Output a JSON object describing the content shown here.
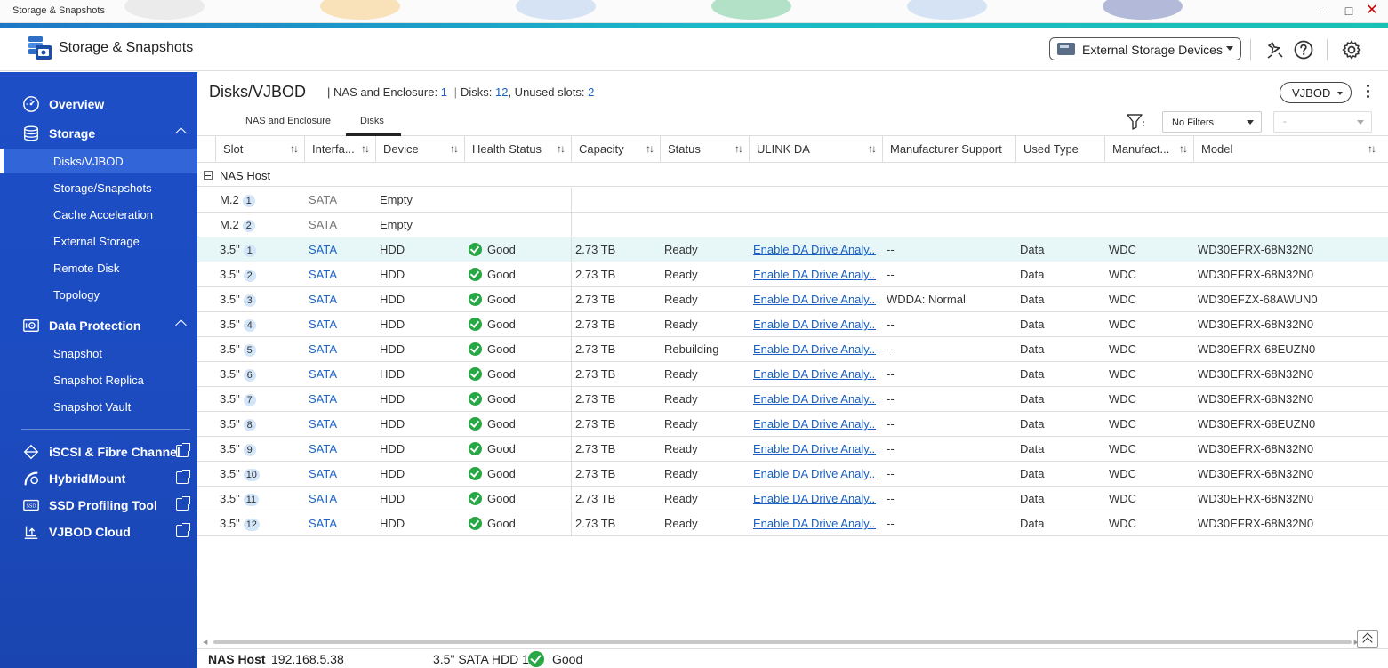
{
  "window": {
    "title": "Storage & Snapshots",
    "min_icon": "minimize-icon",
    "max_icon": "maximize-icon",
    "close_icon": "close-icon"
  },
  "header": {
    "app_title": "Storage & Snapshots",
    "external_devices_label": "External Storage Devices",
    "icons": [
      "pin-tool-icon",
      "help-icon",
      "settings-icon"
    ]
  },
  "sidebar": {
    "sections": [
      {
        "label": "Overview",
        "icon": "gauge-icon"
      },
      {
        "label": "Storage",
        "icon": "database-icon"
      },
      {
        "label": "Data Protection",
        "icon": "safe-icon"
      }
    ],
    "storage_items": [
      "Disks/VJBOD",
      "Storage/Snapshots",
      "Cache Acceleration",
      "External Storage",
      "Remote Disk",
      "Topology"
    ],
    "protection_items": [
      "Snapshot",
      "Snapshot Replica",
      "Snapshot Vault"
    ],
    "tools": [
      {
        "label": "iSCSI & Fibre Channel",
        "icon": "iscsi-icon"
      },
      {
        "label": "HybridMount",
        "icon": "hybridmount-icon"
      },
      {
        "label": "SSD Profiling Tool",
        "icon": "ssd-icon"
      },
      {
        "label": "VJBOD Cloud",
        "icon": "cloud-disk-icon"
      }
    ],
    "active_item": "Disks/VJBOD"
  },
  "page": {
    "title": "Disks/VJBOD",
    "nas_label": "NAS and Enclosure:",
    "nas_count": "1",
    "disks_label": "Disks:",
    "disks_count": "12",
    "unused_label": ", Unused slots:",
    "unused_count": "2",
    "separator": "|",
    "vjbod_button": "VJBOD"
  },
  "tabs": [
    "NAS and Enclosure",
    "Disks"
  ],
  "active_tab": "Disks",
  "filters": {
    "filter_value": "No Filters",
    "secondary_value": "-"
  },
  "table": {
    "columns": [
      "Slot",
      "Interfa...",
      "Device",
      "Health Status",
      "Capacity",
      "Status",
      "ULINK DA",
      "Manufacturer Support",
      "Used Type",
      "Manufact...",
      "Model"
    ],
    "group": "NAS Host",
    "rows": [
      {
        "slot": "M.2",
        "num": "1",
        "iface": "SATA",
        "device": "Empty"
      },
      {
        "slot": "M.2",
        "num": "2",
        "iface": "SATA",
        "device": "Empty"
      },
      {
        "slot": "3.5\"",
        "num": "1",
        "iface": "SATA",
        "device": "HDD",
        "health": "Good",
        "capacity": "2.73 TB",
        "status": "Ready",
        "ulink": "Enable DA Drive Analy...",
        "support": "--",
        "used": "Data",
        "manufacturer": "WDC",
        "model": "WD30EFRX-68N32N0"
      },
      {
        "slot": "3.5\"",
        "num": "2",
        "iface": "SATA",
        "device": "HDD",
        "health": "Good",
        "capacity": "2.73 TB",
        "status": "Ready",
        "ulink": "Enable DA Drive Analy...",
        "support": "--",
        "used": "Data",
        "manufacturer": "WDC",
        "model": "WD30EFRX-68N32N0"
      },
      {
        "slot": "3.5\"",
        "num": "3",
        "iface": "SATA",
        "device": "HDD",
        "health": "Good",
        "capacity": "2.73 TB",
        "status": "Ready",
        "ulink": "Enable DA Drive Analy...",
        "support": "WDDA: Normal",
        "used": "Data",
        "manufacturer": "WDC",
        "model": "WD30EFZX-68AWUN0"
      },
      {
        "slot": "3.5\"",
        "num": "4",
        "iface": "SATA",
        "device": "HDD",
        "health": "Good",
        "capacity": "2.73 TB",
        "status": "Ready",
        "ulink": "Enable DA Drive Analy...",
        "support": "--",
        "used": "Data",
        "manufacturer": "WDC",
        "model": "WD30EFRX-68N32N0"
      },
      {
        "slot": "3.5\"",
        "num": "5",
        "iface": "SATA",
        "device": "HDD",
        "health": "Good",
        "capacity": "2.73 TB",
        "status": "Rebuilding",
        "ulink": "Enable DA Drive Analy...",
        "support": "--",
        "used": "Data",
        "manufacturer": "WDC",
        "model": "WD30EFRX-68EUZN0"
      },
      {
        "slot": "3.5\"",
        "num": "6",
        "iface": "SATA",
        "device": "HDD",
        "health": "Good",
        "capacity": "2.73 TB",
        "status": "Ready",
        "ulink": "Enable DA Drive Analy...",
        "support": "--",
        "used": "Data",
        "manufacturer": "WDC",
        "model": "WD30EFRX-68N32N0"
      },
      {
        "slot": "3.5\"",
        "num": "7",
        "iface": "SATA",
        "device": "HDD",
        "health": "Good",
        "capacity": "2.73 TB",
        "status": "Ready",
        "ulink": "Enable DA Drive Analy...",
        "support": "--",
        "used": "Data",
        "manufacturer": "WDC",
        "model": "WD30EFRX-68N32N0"
      },
      {
        "slot": "3.5\"",
        "num": "8",
        "iface": "SATA",
        "device": "HDD",
        "health": "Good",
        "capacity": "2.73 TB",
        "status": "Ready",
        "ulink": "Enable DA Drive Analy...",
        "support": "--",
        "used": "Data",
        "manufacturer": "WDC",
        "model": "WD30EFRX-68EUZN0"
      },
      {
        "slot": "3.5\"",
        "num": "9",
        "iface": "SATA",
        "device": "HDD",
        "health": "Good",
        "capacity": "2.73 TB",
        "status": "Ready",
        "ulink": "Enable DA Drive Analy...",
        "support": "--",
        "used": "Data",
        "manufacturer": "WDC",
        "model": "WD30EFRX-68N32N0"
      },
      {
        "slot": "3.5\"",
        "num": "10",
        "iface": "SATA",
        "device": "HDD",
        "health": "Good",
        "capacity": "2.73 TB",
        "status": "Ready",
        "ulink": "Enable DA Drive Analy...",
        "support": "--",
        "used": "Data",
        "manufacturer": "WDC",
        "model": "WD30EFRX-68N32N0"
      },
      {
        "slot": "3.5\"",
        "num": "11",
        "iface": "SATA",
        "device": "HDD",
        "health": "Good",
        "capacity": "2.73 TB",
        "status": "Ready",
        "ulink": "Enable DA Drive Analy...",
        "support": "--",
        "used": "Data",
        "manufacturer": "WDC",
        "model": "WD30EFRX-68N32N0"
      },
      {
        "slot": "3.5\"",
        "num": "12",
        "iface": "SATA",
        "device": "HDD",
        "health": "Good",
        "capacity": "2.73 TB",
        "status": "Ready",
        "ulink": "Enable DA Drive Analy...",
        "support": "--",
        "used": "Data",
        "manufacturer": "WDC",
        "model": "WD30EFRX-68N32N0"
      }
    ]
  },
  "statusbar": {
    "host_label": "NAS Host",
    "ip": "192.168.5.38",
    "disk": "3.5\" SATA HDD 1",
    "health": "Good"
  },
  "colors": {
    "sidebar": "#1c4bbf",
    "accent": "#1bb8c9",
    "link": "#1a5fc2",
    "good": "#27a844"
  }
}
